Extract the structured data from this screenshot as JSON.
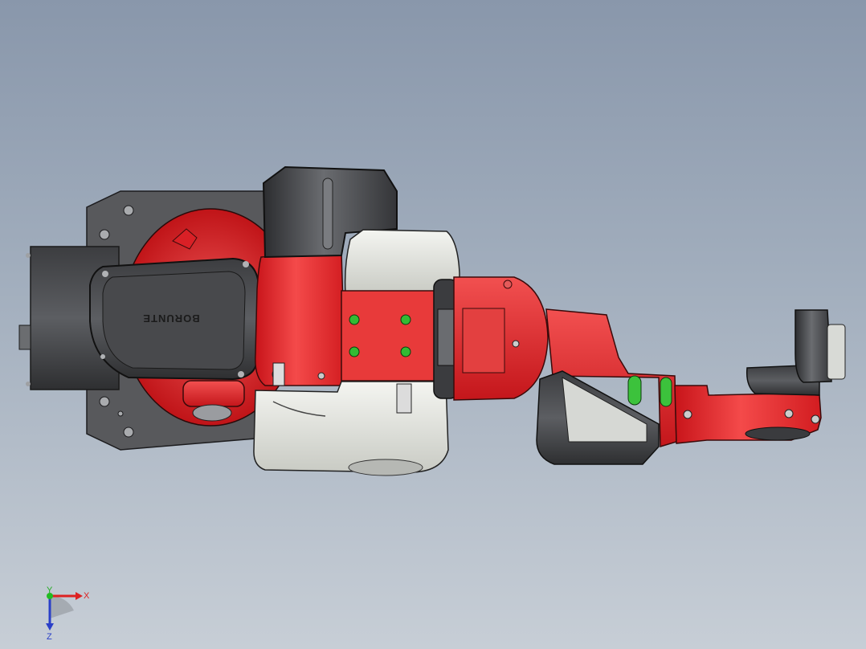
{
  "model": {
    "brand_text": "BORUNTE"
  },
  "triad": {
    "x_label": "X",
    "y_label": "Y",
    "z_label": "Z"
  },
  "colors": {
    "body_red": "#e62a2a",
    "housing_gray": "#505255",
    "cover_white": "#e9ebe6",
    "accent_green": "#3cc23c"
  }
}
